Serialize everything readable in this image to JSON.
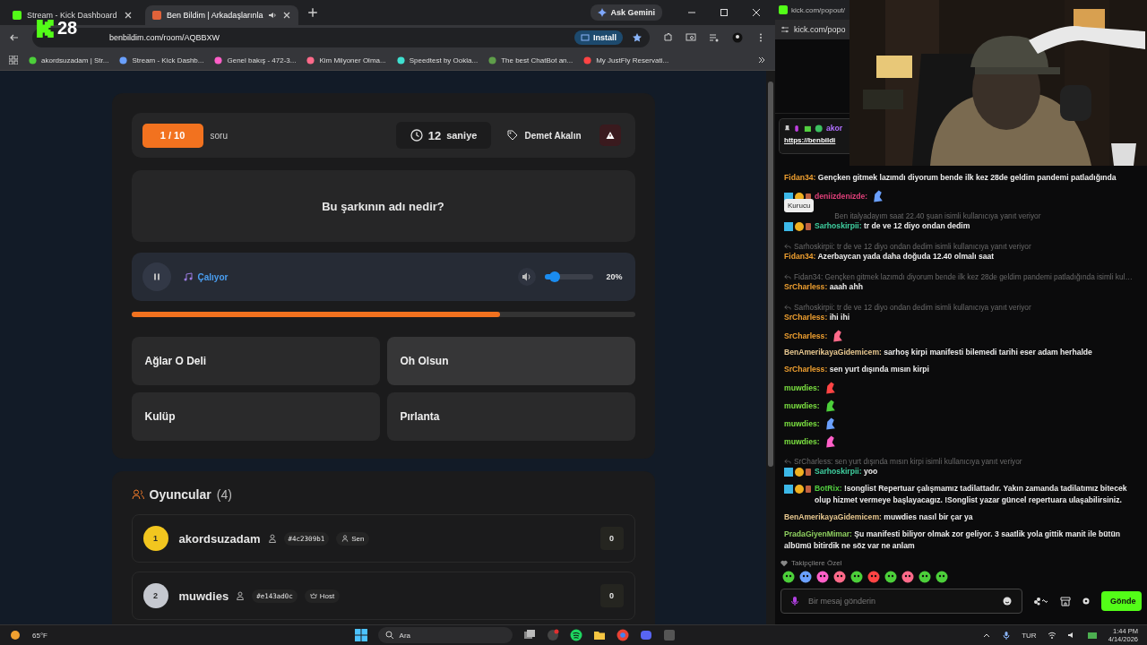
{
  "browser": {
    "tabs": [
      {
        "title": "Stream - Kick Dashboard",
        "selected": false,
        "audio": false
      },
      {
        "title": "Ben Bildim | Arkadaşlarınla",
        "selected": true,
        "audio": true
      }
    ],
    "ask_button": "Ask Gemini",
    "url": "benbildim.com/room/AQBBXW",
    "install_button": "Install",
    "bookmarks": [
      "akordsuzadam | Str...",
      "Stream - Kick Dashb...",
      "Genel bakış - 472-3...",
      "Kim Milyoner Olma...",
      "Speedtest by Ookla...",
      "The best ChatBot an...",
      "My JustFly Reservati..."
    ]
  },
  "stream_overlay": {
    "count": "28"
  },
  "quiz": {
    "counter": "1 / 10",
    "counter_label": "soru",
    "timer_value": "12",
    "timer_unit": "saniye",
    "tag": "Demet Akalın",
    "question": "Bu şarkının adı nedir?",
    "player": {
      "playing": true,
      "status": "Çalıyor",
      "volume": {
        "level": 0.2,
        "reading": "20%"
      }
    },
    "progress": {
      "level": 0.733
    },
    "answers": [
      {
        "text": "Ağlar O Deli",
        "highlighted": false
      },
      {
        "text": "Oh Olsun",
        "highlighted": true
      },
      {
        "text": "Kulüp",
        "highlighted": false
      },
      {
        "text": "Pırlanta",
        "highlighted": false
      }
    ]
  },
  "players": {
    "title": "Oyuncular",
    "count": "(4)",
    "list": [
      {
        "rank": "1",
        "color": "#f2c61f",
        "name": "akordsuzadam",
        "id": "#4c2309b1",
        "role": "Sen",
        "kind": "you",
        "score": "0"
      },
      {
        "rank": "2",
        "color": "#c5c8cf",
        "name": "muwdies",
        "id": "#e143ad0c",
        "role": "Host",
        "kind": "host",
        "score": "0"
      }
    ]
  },
  "chat": {
    "tab_title": "kick.com/popout/",
    "url": "kick.com/popo",
    "pinned": {
      "user": "akor",
      "link": "https://benbildi"
    },
    "messages": [
      {
        "kind": "message",
        "name": "Fidan34:",
        "color": "#f0a030",
        "badged": false,
        "text": "Gençken gitmek lazımdı diyorum bende ilk kez 28de geldim pandemi patladığında"
      },
      {
        "kind": "emote",
        "name": "deniizdenizde:",
        "color": "#e0407a",
        "badged": true
      },
      {
        "kind": "reply",
        "text": "Ben italyadayım saat 22.40 şuan isimli kullanıcıya yanıt veriyor",
        "tooltip": "Kurucu"
      },
      {
        "kind": "message",
        "name": "Sarhoskirpii:",
        "color": "#3fd0a0",
        "badged": true,
        "text": "tr de ve 12 diyo ondan dedim"
      },
      {
        "kind": "reply",
        "text": "Sarhoskirpii: tr de ve 12 diyo ondan dedim isimli kullanıcıya yanıt veriyor"
      },
      {
        "kind": "message",
        "name": "Fidan34:",
        "color": "#f0a030",
        "badged": false,
        "text": "Azerbaycan yada daha doğuda 12.40 olmalı saat"
      },
      {
        "kind": "reply",
        "text": "Fidan34: Gençken gitmek lazımdı diyorum bende ilk kez 28de geldim pandemi patladığında isimli kul…"
      },
      {
        "kind": "message",
        "name": "SrCharless:",
        "color": "#f0a030",
        "badged": false,
        "text": "aaah ahh"
      },
      {
        "kind": "reply",
        "text": "Sarhoskirpii: tr de ve 12 diyo ondan dedim isimli kullanıcıya yanıt veriyor"
      },
      {
        "kind": "message",
        "name": "SrCharless:",
        "color": "#f0a030",
        "badged": false,
        "text": "ihi ihi"
      },
      {
        "kind": "emote",
        "name": "SrCharless:",
        "color": "#f0a030",
        "badged": false
      },
      {
        "kind": "message",
        "name": "BenAmerikayaGidemicem:",
        "color": "#e8c890",
        "badged": false,
        "text": "sarhoş kirpi manifesti bilemedi tarihi eser adam herhalde"
      },
      {
        "kind": "message",
        "name": "SrCharless:",
        "color": "#f0a030",
        "badged": false,
        "text": "sen yurt dışında mısın kirpi"
      },
      {
        "kind": "emote",
        "name": "muwdies:",
        "color": "#7be041",
        "badged": false
      },
      {
        "kind": "emote",
        "name": "muwdies:",
        "color": "#7be041",
        "badged": false
      },
      {
        "kind": "emote",
        "name": "muwdies:",
        "color": "#7be041",
        "badged": false
      },
      {
        "kind": "emote",
        "name": "muwdies:",
        "color": "#7be041",
        "badged": false
      },
      {
        "kind": "reply",
        "text": "SrCharless: sen yurt dışında mısın kirpi isimli kullanıcıya yanıt veriyor"
      },
      {
        "kind": "message",
        "name": "Sarhoskirpii:",
        "color": "#3fd0a0",
        "badged": true,
        "text": "yoo"
      },
      {
        "kind": "message",
        "name": "BotRix:",
        "color": "#53d040",
        "badged": true,
        "text": "!songlist Repertuar çalışmamız tadilattadır. Yakın zamanda tadilatımız bitecek olup hizmet vermeye başlayacagız. !Songlist yazar güncel repertuara ulaşabilirsiniz."
      },
      {
        "kind": "message",
        "name": "BenAmerikayaGidemicem:",
        "color": "#e8c890",
        "badged": false,
        "text": "muwdies nasıl bir çar ya"
      },
      {
        "kind": "message",
        "name": "PradaGiyenMimar:",
        "color": "#8fd060",
        "badged": false,
        "text": "Şu manifesti biliyor olmak zor geliyor. 3 saatlik yola gittik manit ile bütün albümü bitirdik ne söz var ne anlam"
      }
    ],
    "emote_section": "Takipçilere Özel",
    "input_placeholder": "Bir mesaj gönderin",
    "send_button": "Gönde"
  },
  "taskbar": {
    "weather": "65°F",
    "search": "Ara",
    "language": "TUR",
    "time": "1:44 PM",
    "date": "4/14/2026"
  }
}
